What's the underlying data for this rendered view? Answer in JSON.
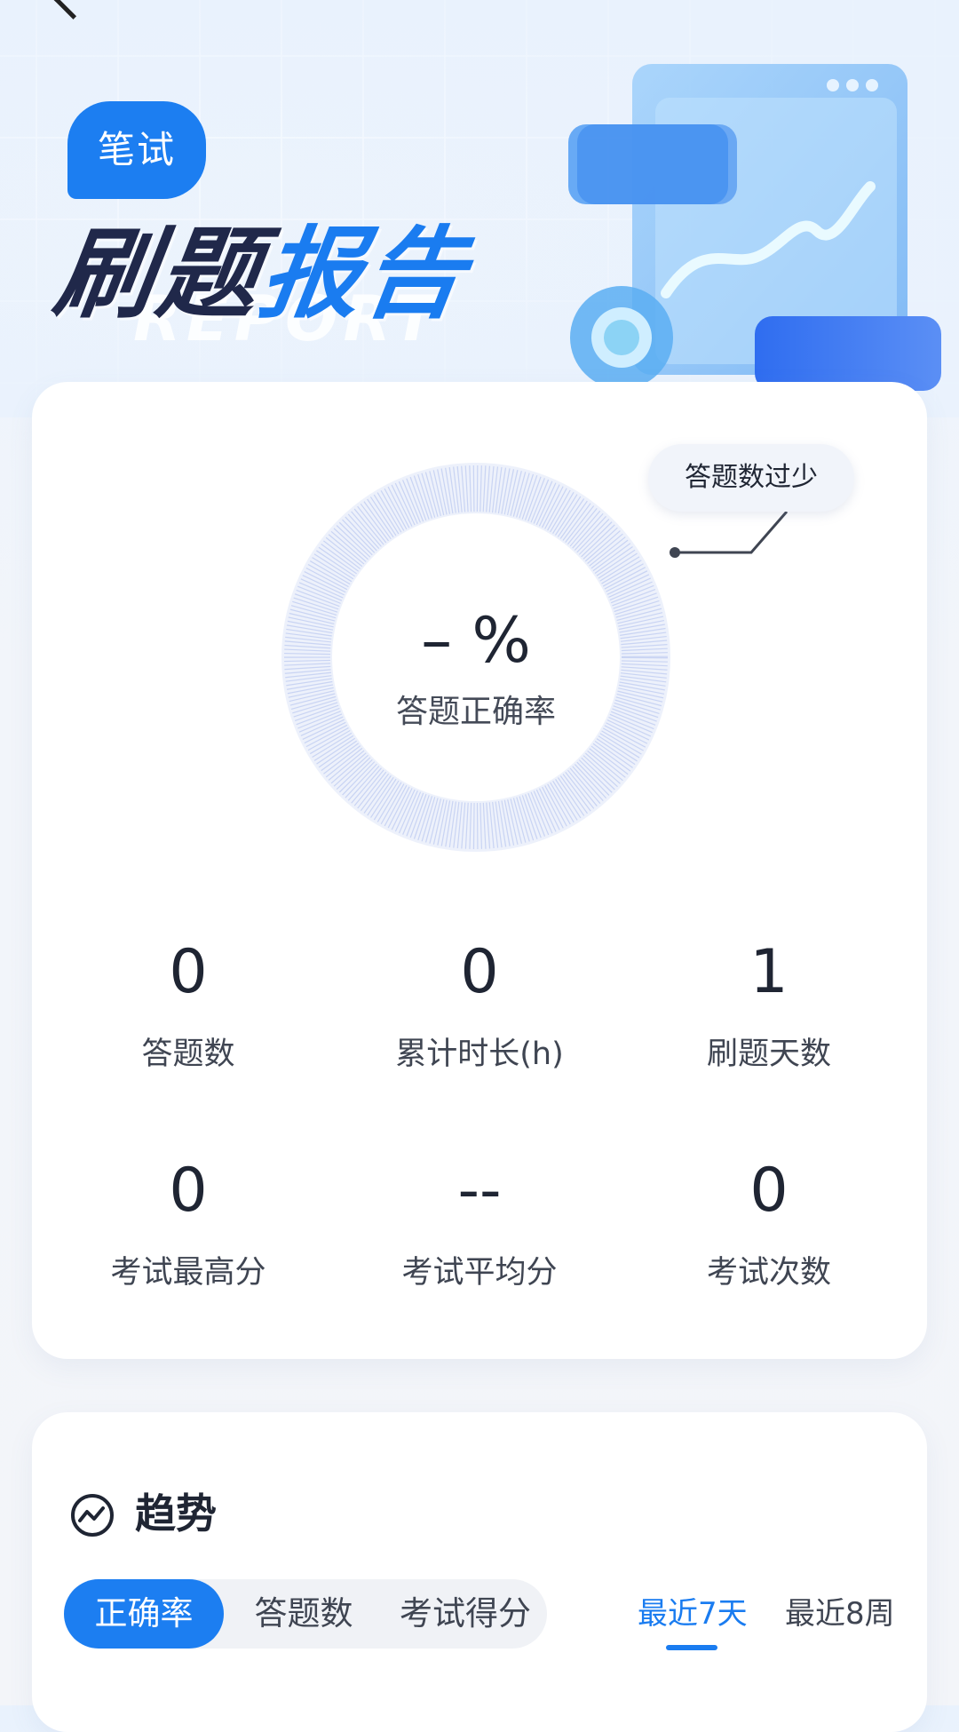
{
  "header": {
    "tag_label": "笔试",
    "title_dark": "刷题",
    "title_blue": "报告",
    "title_tail": "",
    "ghost_text": "REPORT"
  },
  "accuracy": {
    "value": "– %",
    "label": "答题正确率",
    "tip": "答题数过少"
  },
  "stats": [
    {
      "value": "0",
      "label": "答题数"
    },
    {
      "value": "0",
      "label": "累计时长(h)"
    },
    {
      "value": "1",
      "label": "刷题天数"
    },
    {
      "value": "0",
      "label": "考试最高分"
    },
    {
      "value": "--",
      "label": "考试平均分"
    },
    {
      "value": "0",
      "label": "考试次数"
    }
  ],
  "trend": {
    "title": "趋势",
    "tabs": [
      "正确率",
      "答题数",
      "考试得分"
    ],
    "active_tab": "正确率",
    "ranges": [
      "最近7天",
      "最近8周"
    ],
    "active_range": "最近7天"
  },
  "colors": {
    "accent": "#1c7ef1",
    "title_dark": "#20284a",
    "ring": "#c9d4f3"
  }
}
